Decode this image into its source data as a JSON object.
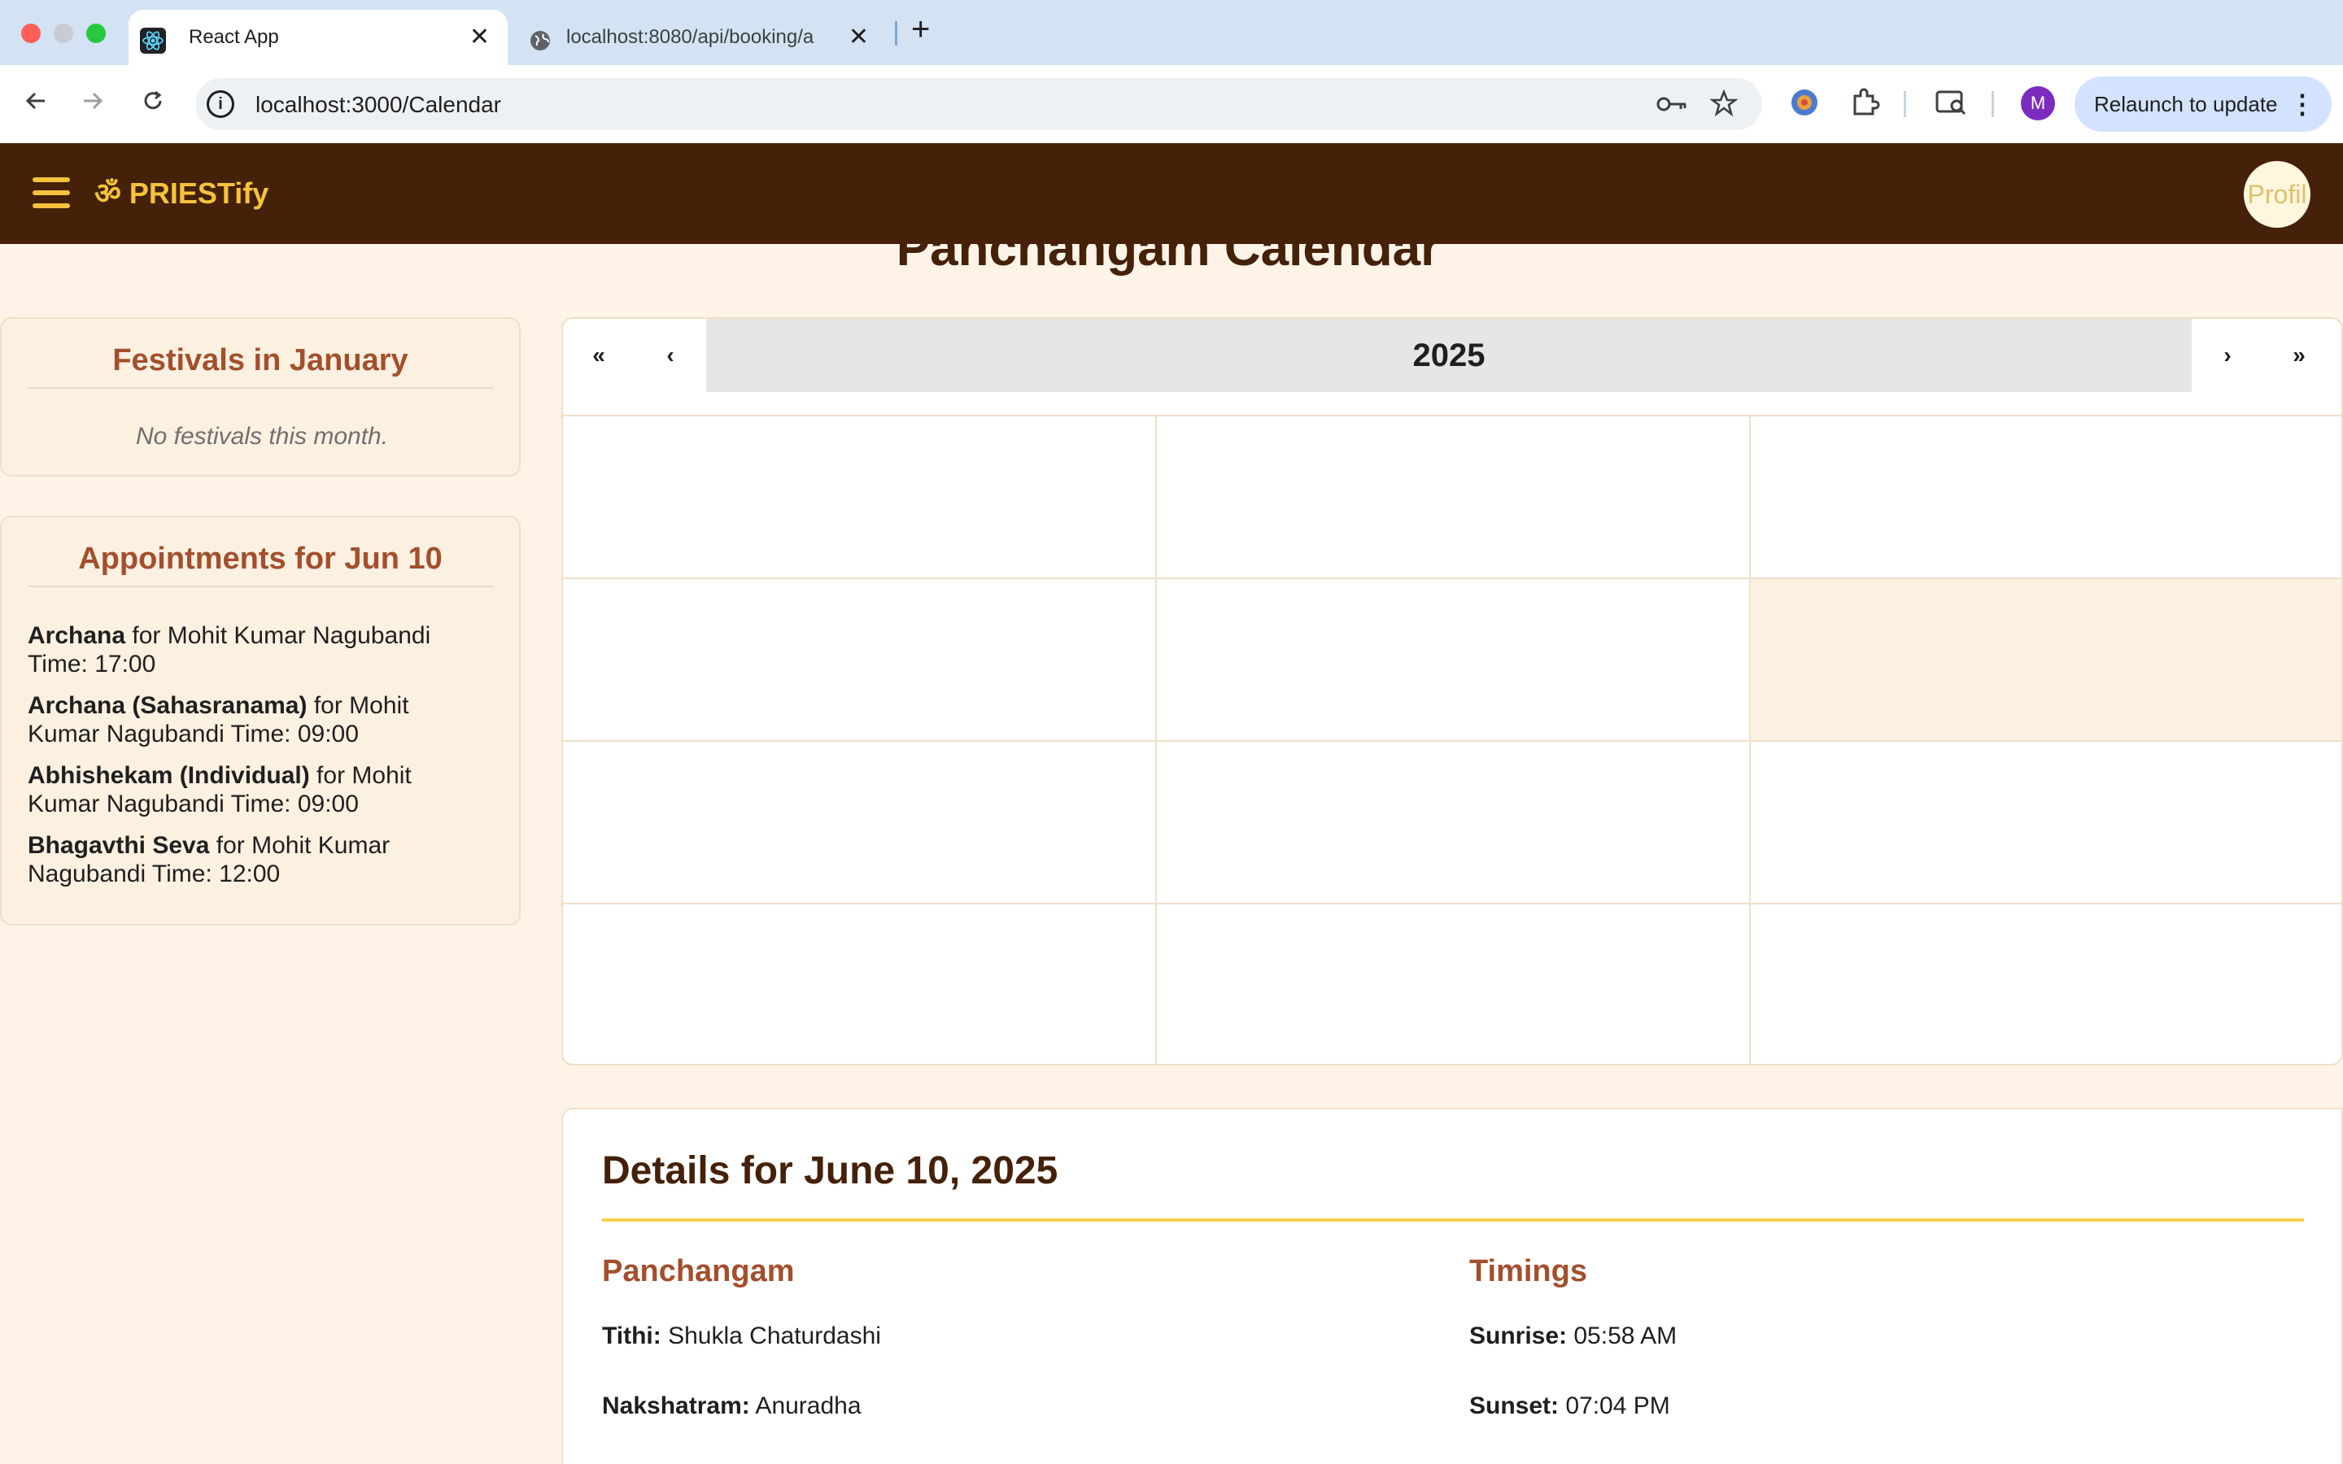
{
  "browser": {
    "tabs": [
      {
        "title": "React App",
        "active": true,
        "icon": "react-icon"
      },
      {
        "title": "localhost:8080/api/booking/a",
        "active": false,
        "icon": "globe-icon"
      }
    ],
    "url": "localhost:3000/Calendar",
    "relaunch_label": "Relaunch to update",
    "profile_initial": "M",
    "close_glyph": "✕",
    "new_tab_glyph": "+"
  },
  "app": {
    "brand": "ॐ PRIESTify",
    "avatar_alt": "Profil",
    "page_title": "Panchangam Calendar",
    "colors": {
      "header": "#452109",
      "accent": "#f5c23c",
      "heading": "#a34f2d",
      "background": "#fdf4e7"
    }
  },
  "festivals": {
    "heading": "Festivals in January",
    "empty": "No festivals this month."
  },
  "appointments": {
    "heading": "Appointments for Jun 10",
    "items": [
      {
        "service": "Archana",
        "rest": " for Mohit Kumar Nagubandi  Time: 17:00"
      },
      {
        "service": "Archana (Sahasranama)",
        "rest": " for Mohit Kumar Nagubandi  Time: 09:00"
      },
      {
        "service": "Abhishekam (Individual)",
        "rest": " for Mohit Kumar Nagubandi  Time: 09:00"
      },
      {
        "service": "Bhagavthi Seva",
        "rest": " for Mohit Kumar Nagubandi  Time: 12:00"
      }
    ]
  },
  "calendar": {
    "label": "2025",
    "nav": {
      "prev2": "«",
      "prev": "‹",
      "next": "›",
      "next2": "»"
    },
    "highlighted_tile": 6
  },
  "details": {
    "title": "Details for June 10, 2025",
    "panchangam_heading": "Panchangam",
    "timings_heading": "Timings",
    "tithi_label": "Tithi:",
    "tithi_value": " Shukla Chaturdashi",
    "nakshatram_label": "Nakshatram:",
    "nakshatram_value": " Anuradha",
    "sunrise_label": "Sunrise:",
    "sunrise_value": " 05:58 AM",
    "sunset_label": "Sunset:",
    "sunset_value": " 07:04 PM"
  }
}
